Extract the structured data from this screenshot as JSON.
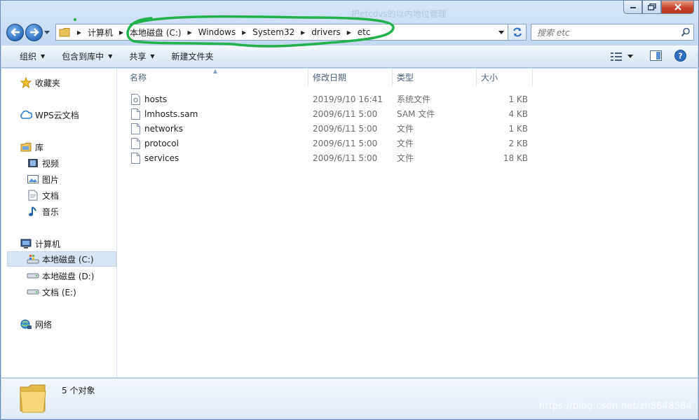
{
  "window": {
    "blurred_title": "把etcdvs的以内地位管理"
  },
  "nav": {
    "breadcrumbs": [
      "计算机",
      "本地磁盘 (C:)",
      "Windows",
      "System32",
      "drivers",
      "etc"
    ],
    "search_placeholder": "搜索 etc"
  },
  "toolbar": {
    "organize": "组织",
    "include_library": "包含到库中",
    "share": "共享",
    "new_folder": "新建文件夹"
  },
  "sidebar": {
    "favorites": "收藏夹",
    "wps": "WPS云文档",
    "libraries": "库",
    "videos": "视频",
    "pictures": "图片",
    "documents": "文档",
    "music": "音乐",
    "computer": "计算机",
    "drive_c": "本地磁盘 (C:)",
    "drive_d": "本地磁盘 (D:)",
    "drive_e": "文档 (E:)",
    "network": "网络"
  },
  "columns": {
    "name": "名称",
    "date": "修改日期",
    "type": "类型",
    "size": "大小"
  },
  "files": [
    {
      "name": "hosts",
      "date": "2019/9/10 16:41",
      "type": "系统文件",
      "size": "1 KB",
      "icon": "system-file-icon"
    },
    {
      "name": "lmhosts.sam",
      "date": "2009/6/11 5:00",
      "type": "SAM 文件",
      "size": "4 KB",
      "icon": "file-icon"
    },
    {
      "name": "networks",
      "date": "2009/6/11 5:00",
      "type": "文件",
      "size": "1 KB",
      "icon": "file-icon"
    },
    {
      "name": "protocol",
      "date": "2009/6/11 5:00",
      "type": "文件",
      "size": "2 KB",
      "icon": "file-icon"
    },
    {
      "name": "services",
      "date": "2009/6/11 5:00",
      "type": "文件",
      "size": "18 KB",
      "icon": "file-icon"
    }
  ],
  "status": {
    "count": "5 个对象"
  },
  "watermark": "https://blog.csdn.net/zh5648584",
  "colors": {
    "annotation": "#22b14c",
    "accent": "#3a78c8"
  }
}
